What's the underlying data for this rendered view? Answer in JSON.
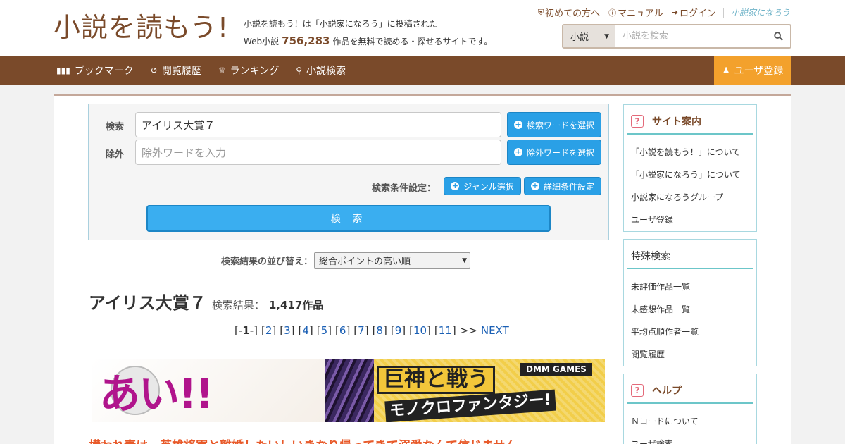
{
  "header": {
    "logo": "小説を読もう!",
    "tagline_line1": "小説を読もう！は「小説家になろう」に投稿された",
    "tagline_pre": "Web小説",
    "tagline_count": "756,283",
    "tagline_post": "作品を無料で読める・探せるサイトです。",
    "toplinks": {
      "beginners": "初めての方へ",
      "manual": "マニュアル",
      "login": "ログイン",
      "brand": "小説家になろう"
    },
    "search": {
      "category": "小説",
      "placeholder": "小説を検索"
    }
  },
  "nav": {
    "bookmark": "ブックマーク",
    "history": "閲覧履歴",
    "ranking": "ランキング",
    "search": "小説検索",
    "register": "ユーザ登録"
  },
  "search_panel": {
    "keyword_label": "検索",
    "keyword_value": "アイリス大賞７",
    "keyword_button": "検索ワードを選択",
    "exclude_label": "除外",
    "exclude_placeholder": "除外ワードを入力",
    "exclude_button": "除外ワードを選択",
    "conditions_label": "検索条件設定：",
    "genre_button": "ジャンル選択",
    "detail_button": "詳細条件設定",
    "submit": "検 索"
  },
  "sort": {
    "label": "検索結果の並び替え：",
    "selected": "総合ポイントの高い順"
  },
  "results": {
    "query": "アイリス大賞７",
    "label": "検索結果：",
    "count": "1,417作品"
  },
  "pager": {
    "current": "1",
    "pages": [
      "2",
      "3",
      "4",
      "5",
      "6",
      "7",
      "8",
      "9",
      "10",
      "11"
    ],
    "arrow": ">>",
    "next": "NEXT"
  },
  "banner": {
    "big_text": "あい!!",
    "headline": "巨神と戦う",
    "sub": "モノクロファンタジー!",
    "logo": "DMM GAMES"
  },
  "first_result_title": "構われ妻は、英雄将軍と離婚したい！いきなり帰ってきて溺愛なんて信じません。",
  "sidebar": {
    "site_guide": {
      "title": "サイト案内",
      "items": [
        "「小説を読もう！」について",
        "「小説家になろう」について",
        "小説家になろうグループ",
        "ユーザ登録"
      ]
    },
    "special_search": {
      "title": "特殊検索",
      "items": [
        "未評価作品一覧",
        "未感想作品一覧",
        "平均点順作者一覧",
        "閲覧履歴"
      ]
    },
    "help": {
      "title": "ヘルプ",
      "items": [
        "Ｎコードについて",
        "ユーザ検索"
      ]
    }
  },
  "colors": {
    "brand_brown": "#7a4a2a",
    "accent_orange": "#f3a12c",
    "button_blue": "#2aa0e6",
    "sidebar_teal": "#6cc6c9",
    "title_orange": "#e85a2a"
  }
}
